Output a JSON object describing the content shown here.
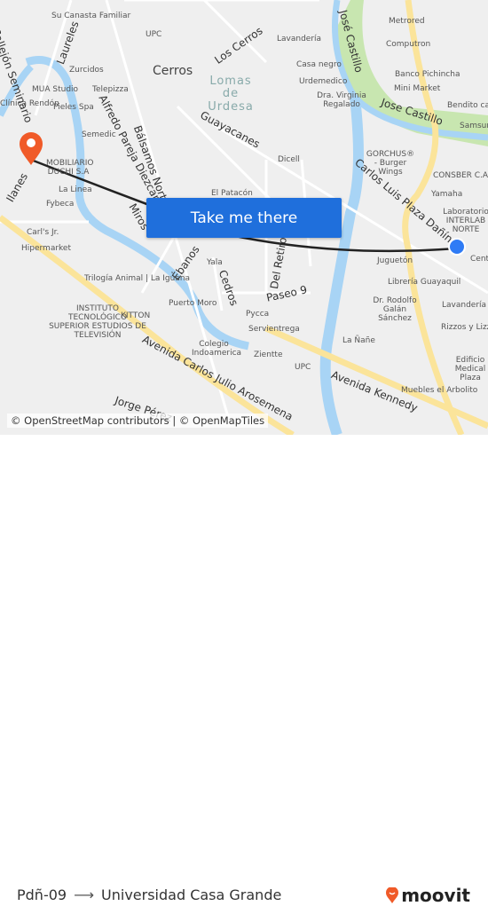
{
  "map": {
    "streets": [
      "Alfredo Pareja Diezcanseco",
      "Laureles",
      "Los Cerros",
      "Guayacanes",
      "Carlos Luis Plaza Dañín",
      "José Castillo",
      "Jose Castillo",
      "Bálsamos Norte",
      "Miros",
      "Ébanos",
      "Cedros",
      "Del Retiro",
      "Paseo 9",
      "Avenida Carlos Julio Arosemena",
      "Avenida Kennedy",
      "Callejón Seminario",
      "Ilanes",
      "Jorge Pérez"
    ],
    "areas": [
      "Cerros",
      "Lomas de Urdesa"
    ],
    "pois": [
      "Su Canasta Familiar",
      "UPC",
      "Lavandería",
      "Metrored",
      "Computron",
      "Zurcidos",
      "Casa negro",
      "Banco Pichincha",
      "MUA Studio",
      "Telepizza",
      "Urdemedico",
      "Mini Market",
      "Pieles Spa",
      "Dra. Virginia Regalado",
      "Bendito café",
      "Clínica Rendón",
      "Semedic",
      "Samsung",
      "Dicell",
      "GORCHUS® - Burger Wings",
      "MOBILIARIO DUCHI S.A",
      "CONSBER C.A.",
      "El Patacón",
      "Yamaha",
      "La Linea",
      "Fybeca",
      "Laboratorio INTERLAB NORTE",
      "Carl's Jr.",
      "Hipermarket",
      "Yala",
      "Juguetón",
      "Centro",
      "Trilogía Animal | La Iguana",
      "Librería Guayaquil",
      "Puerto Moro",
      "Dr. Rodolfo Galán Sánchez",
      "INSTITUTO TECNOLÓGICO SUPERIOR ESTUDIOS DE TELEVISIÓN",
      "KITTON",
      "Pycca",
      "Lavandería",
      "Servientrega",
      "Rizzos y Lizzos",
      "La Ñañe",
      "Colegio Indoamerica",
      "Zientte",
      "UPC",
      "Edificio Medical Plaza",
      "Muebles el Arbolito"
    ],
    "colors": {
      "route": "#222222",
      "destination_pin": "#f05a28",
      "origin_dot": "#2f7bf5",
      "water": "#a8d4f5",
      "park": "#c8e6b0",
      "major_road": "#fbe49a"
    }
  },
  "cta": {
    "label": "Take me there"
  },
  "attribution": "© OpenStreetMap contributors | © OpenMapTiles",
  "footer": {
    "origin": "Pdñ-09",
    "destination": "Universidad Casa Grande",
    "brand": "moovit"
  }
}
